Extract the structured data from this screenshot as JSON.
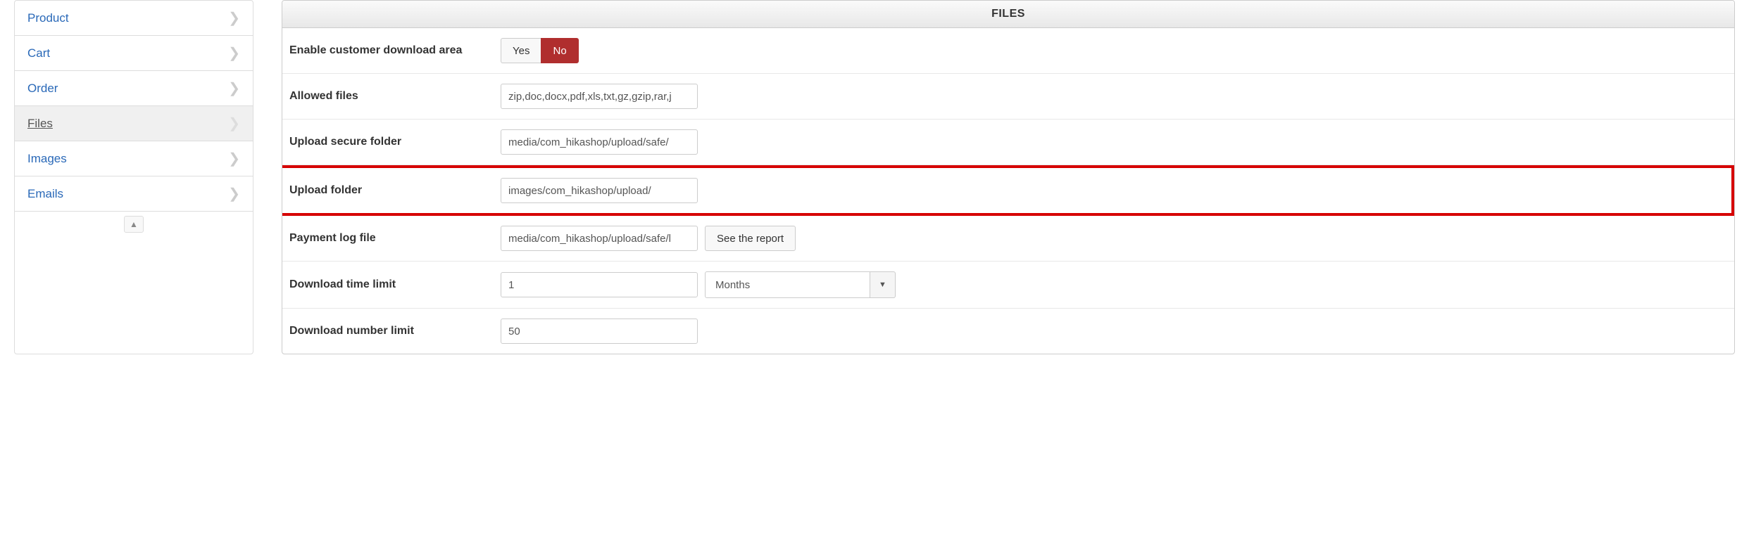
{
  "sidebar": {
    "items": [
      {
        "label": "Product"
      },
      {
        "label": "Cart"
      },
      {
        "label": "Order"
      },
      {
        "label": "Files"
      },
      {
        "label": "Images"
      },
      {
        "label": "Emails"
      }
    ]
  },
  "panel": {
    "title": "FILES"
  },
  "fields": {
    "enable_download_area": {
      "label": "Enable customer download area",
      "yes": "Yes",
      "no": "No"
    },
    "allowed_files": {
      "label": "Allowed files",
      "value": "zip,doc,docx,pdf,xls,txt,gz,gzip,rar,j"
    },
    "upload_secure_folder": {
      "label": "Upload secure folder",
      "value": "media/com_hikashop/upload/safe/"
    },
    "upload_folder": {
      "label": "Upload folder",
      "value": "images/com_hikashop/upload/"
    },
    "payment_log_file": {
      "label": "Payment log file",
      "value": "media/com_hikashop/upload/safe/l",
      "button": "See the report"
    },
    "download_time_limit": {
      "label": "Download time limit",
      "value": "1",
      "unit": "Months"
    },
    "download_number_limit": {
      "label": "Download number limit",
      "value": "50"
    }
  }
}
